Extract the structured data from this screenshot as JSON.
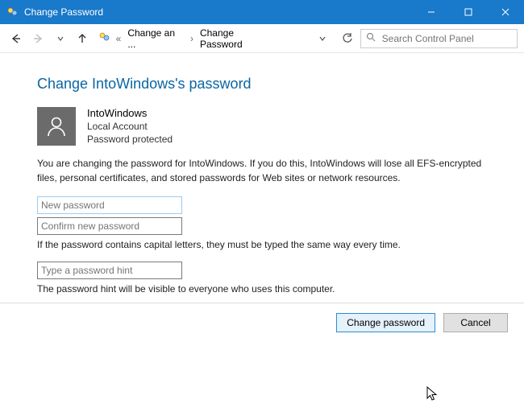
{
  "window": {
    "title": "Change Password"
  },
  "toolbar": {
    "breadcrumb1": "Change an ...",
    "breadcrumb2": "Change Password",
    "search_placeholder": "Search Control Panel"
  },
  "heading": "Change IntoWindows's password",
  "user": {
    "name": "IntoWindows",
    "type": "Local Account",
    "status": "Password protected"
  },
  "warning": "You are changing the password for IntoWindows.  If you do this, IntoWindows will lose all EFS-encrypted files, personal certificates, and stored passwords for Web sites or network resources.",
  "fields": {
    "new_password_placeholder": "New password",
    "confirm_password_placeholder": "Confirm new password",
    "caps_note": "If the password contains capital letters, they must be typed the same way every time.",
    "hint_placeholder": "Type a password hint",
    "hint_note": "The password hint will be visible to everyone who uses this computer."
  },
  "buttons": {
    "change": "Change password",
    "cancel": "Cancel"
  }
}
